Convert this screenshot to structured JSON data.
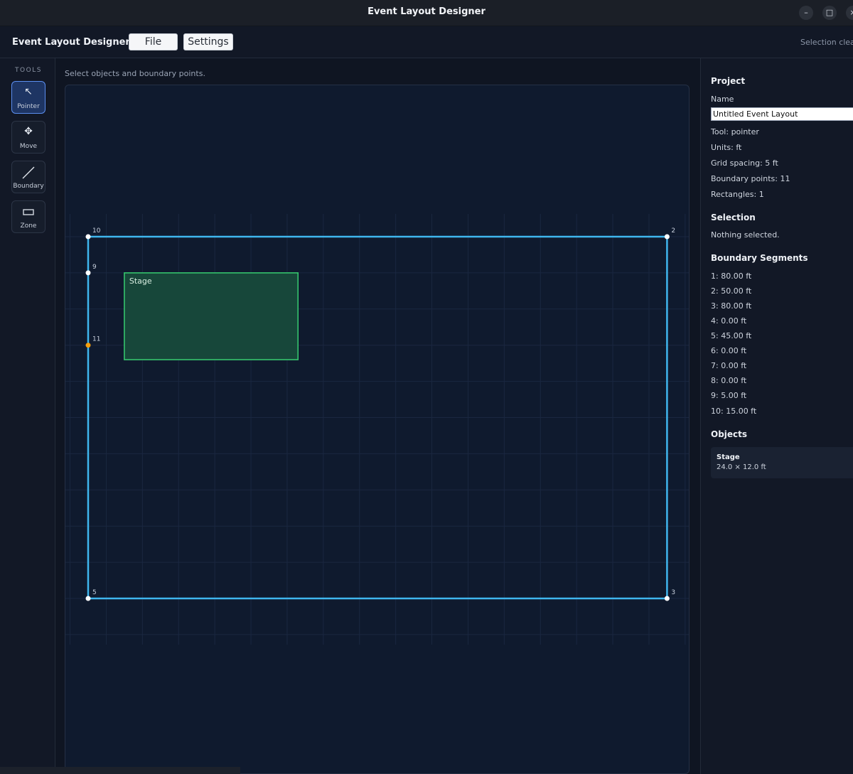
{
  "window": {
    "title": "Event Layout Designer",
    "controls": [
      "minimize",
      "maximize",
      "close"
    ]
  },
  "appbar": {
    "name": "Event Layout Designer",
    "file_label": "File",
    "settings_label": "Settings",
    "status": "Selection cleared"
  },
  "tools": {
    "heading": "TOOLS",
    "items": [
      {
        "label": "Pointer",
        "icon": "pointer-arrow-icon",
        "active": true
      },
      {
        "label": "Move",
        "icon": "move-arrows-icon",
        "active": false
      },
      {
        "label": "Boundary",
        "icon": "boundary-line-icon",
        "active": false
      },
      {
        "label": "Zone",
        "icon": "zone-rectangle-icon",
        "active": false
      }
    ]
  },
  "canvas": {
    "hint": "Select objects and boundary points.",
    "units": "ft",
    "boundary_points": [
      {
        "label": "10",
        "x": 0,
        "y": 0,
        "selected": false
      },
      {
        "label": "2",
        "x": 80,
        "y": 0,
        "selected": false
      },
      {
        "label": "3",
        "x": 80,
        "y": 50,
        "selected": false
      },
      {
        "label": "5",
        "x": 0,
        "y": 50,
        "selected": false
      },
      {
        "label": "9",
        "x": 0,
        "y": 5,
        "selected": false
      },
      {
        "label": "11",
        "x": 0,
        "y": 15,
        "selected": true
      }
    ],
    "zones": [
      {
        "label": "Stage",
        "x": 5,
        "y": 5,
        "w": 24,
        "h": 12
      }
    ],
    "colors": {
      "boundary": "#3fb6ee",
      "zone_fill": "#17473a",
      "zone_stroke": "#35c46d",
      "point": "#ffffff",
      "selected_point": "#f59e0b",
      "grid": "#1a2740"
    }
  },
  "side": {
    "project_heading": "Project",
    "name_label": "Name",
    "name_value": "Untitled Event Layout",
    "tool": "Tool: pointer",
    "units": "Units: ft",
    "grid": "Grid spacing: 5 ft",
    "boundary_points": "Boundary points: 11",
    "rectangles": "Rectangles: 1",
    "selection_heading": "Selection",
    "selection_text": "Nothing selected.",
    "segments_heading": "Boundary Segments",
    "segments": [
      "1: 80.00 ft",
      "2: 50.00 ft",
      "3: 80.00 ft",
      "4: 0.00 ft",
      "5: 45.00 ft",
      "6: 0.00 ft",
      "7: 0.00 ft",
      "8: 0.00 ft",
      "9: 5.00 ft",
      "10: 15.00 ft"
    ],
    "objects_heading": "Objects",
    "objects": [
      {
        "name": "Stage",
        "dims": "24.0 × 12.0 ft"
      }
    ]
  }
}
